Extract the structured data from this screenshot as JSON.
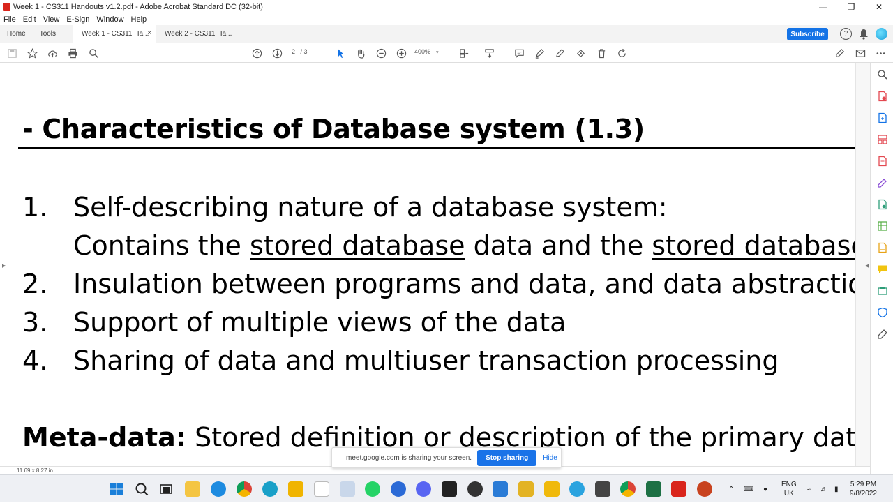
{
  "window": {
    "title": "Week 1 - CS311 Handouts v1.2.pdf - Adobe Acrobat Standard DC (32-bit)",
    "minimize": "—",
    "maximize": "❐",
    "close": "✕"
  },
  "menu": [
    "File",
    "Edit",
    "View",
    "E-Sign",
    "Window",
    "Help"
  ],
  "tabs": {
    "home": "Home",
    "tools": "Tools",
    "documents": [
      {
        "label": "Week 1 - CS311 Ha...",
        "active": true,
        "close": "×"
      },
      {
        "label": "Week 2 - CS311 Ha...",
        "active": false
      }
    ],
    "subscribe": "Subscribe",
    "help": "?"
  },
  "toolbar": {
    "page_current": "2",
    "page_total": "/ 3",
    "zoom": "400%",
    "zoom_caret": "▾"
  },
  "document": {
    "heading": "- Characteristics of Database system (1.3)",
    "items": [
      {
        "num": "1.",
        "text": "Self-describing nature of a database system:"
      },
      {
        "cont_a": "Contains the ",
        "cont_u1": "stored database",
        "cont_b": " data and the ",
        "cont_u2": "stored database de"
      },
      {
        "num": "2.",
        "text": "Insulation between programs and data, and data abstraction"
      },
      {
        "num": "3.",
        "text": "Support of multiple views of the data"
      },
      {
        "num": "4.",
        "text": "Sharing of data and multiuser transaction processing"
      }
    ],
    "meta_label": "Meta-data:",
    "meta_text": " Stored definition or description of the primary databa",
    "page_size": "11.69 x 8.27 in"
  },
  "share_bar": {
    "message": "meet.google.com is sharing your screen.",
    "stop": "Stop sharing",
    "hide": "Hide"
  },
  "taskbar": {
    "language": "ENG",
    "region": "UK",
    "time": "5:29 PM",
    "date": "9/8/2022"
  },
  "colors": {
    "accent": "#1473e6",
    "acrobat_red": "#d9251c",
    "taskbar": "#eef0f4"
  }
}
